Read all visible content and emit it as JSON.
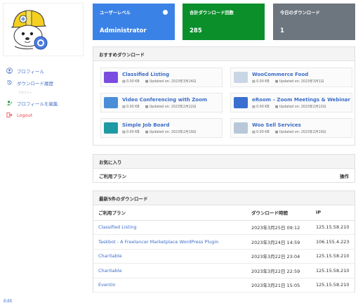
{
  "sidebar": {
    "items": [
      {
        "icon": "user-circle-icon",
        "label": "プロフィール"
      },
      {
        "icon": "history-icon",
        "label": "ダウンロード履歴"
      }
    ],
    "section_label": "アカウント",
    "account_items": [
      {
        "icon": "user-edit-icon",
        "label": "プロフィールを編集"
      },
      {
        "icon": "logout-icon",
        "label": "Logout"
      }
    ],
    "edit_label": "Edit"
  },
  "stats": {
    "user_level": {
      "label": "ユーザーレベル",
      "value": "Administrator",
      "color": "#3b82e6"
    },
    "total_downloads": {
      "label": "合計ダウンロード回数",
      "value": "285",
      "color": "#0a8f2a"
    },
    "today_downloads": {
      "label": "今日のダウンロード",
      "value": "1",
      "color": "#6d757e"
    }
  },
  "recommended": {
    "title": "おすすめダウンロード",
    "items": [
      {
        "title": "Classified Listing",
        "size": "0.00 KB",
        "updated": "Updated on: 2023年3月24日",
        "thumb_color": "#7b4ce0"
      },
      {
        "title": "WooCommerce Food",
        "size": "0.00 KB",
        "updated": "Updated on: 2023年3月1日",
        "thumb_color": "#c9d6e6"
      },
      {
        "title": "Video Conferencing with Zoom",
        "size": "0.00 KB",
        "updated": "Updated on: 2023年2月22日",
        "thumb_color": "#4b8ed8"
      },
      {
        "title": "eRoom – Zoom Meetings & Webinar",
        "size": "0.00 KB",
        "updated": "Updated on: 2023年2月22日",
        "thumb_color": "#3a6fd0"
      },
      {
        "title": "Simple Job Board",
        "size": "0.00 KB",
        "updated": "Updated on: 2023年2月19日",
        "thumb_color": "#1e9aa4"
      },
      {
        "title": "Woo Sell Services",
        "size": "0.00 KB",
        "updated": "Updated on: 2023年2月19日",
        "thumb_color": "#b9c8d8"
      }
    ]
  },
  "favorites": {
    "title": "お気に入り",
    "col_plan": "ご利用プラン",
    "col_action": "操作"
  },
  "latest": {
    "title": "最新5件のダウンロード",
    "headers": [
      "ご利用プラン",
      "ダウンロード時間",
      "IP"
    ],
    "rows": [
      {
        "plan": "Classified Listing",
        "time": "2023年3月25日 09:12",
        "ip": "125.15.58.210"
      },
      {
        "plan": "Taskbot - A Freelancer Marketplace WordPress Plugin",
        "time": "2023年3月24日 14:59",
        "ip": "106.155.4.223"
      },
      {
        "plan": "Charitable",
        "time": "2023年3月22日 23:04",
        "ip": "125.15.58.210"
      },
      {
        "plan": "Charitable",
        "time": "2023年3月22日 22:59",
        "ip": "125.15.58.210"
      },
      {
        "plan": "Eventin",
        "time": "2023年3月21日 15:05",
        "ip": "125.15.58.210"
      }
    ]
  }
}
